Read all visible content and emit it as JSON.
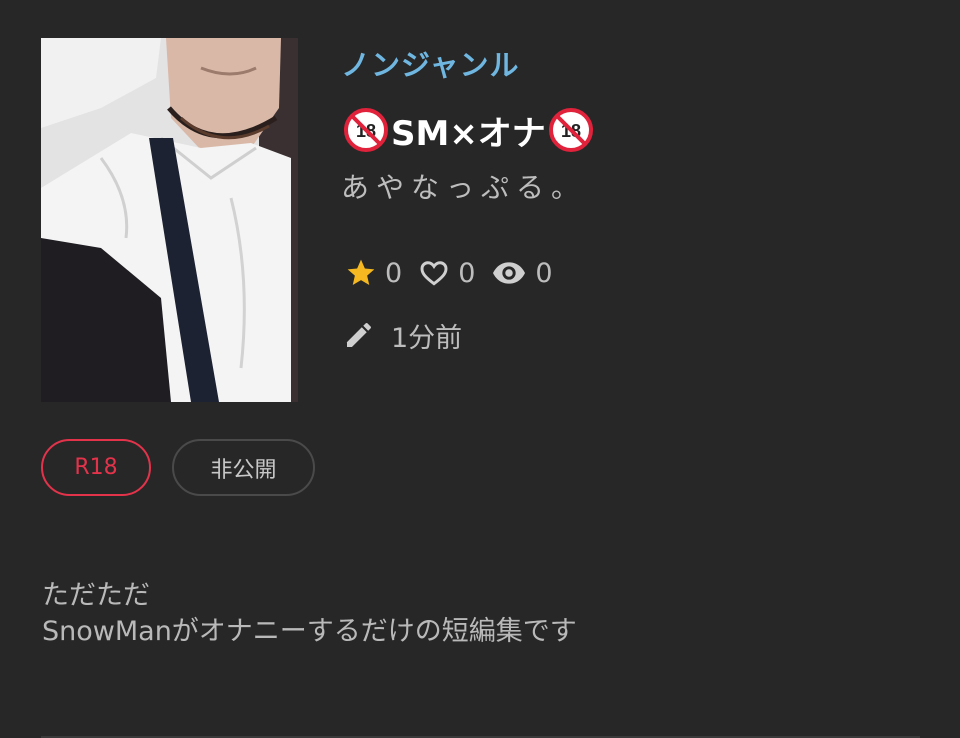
{
  "work": {
    "genre": "ノンジャンル",
    "title_text": "SM×オナ",
    "author": "あやなっぷる。",
    "cover_icon": "cover-image",
    "badge_icon": "no-under-18-icon"
  },
  "stats": {
    "stars": "0",
    "hearts": "0",
    "views": "0",
    "star_color": "#f5b820"
  },
  "updated": "1分前",
  "tags": {
    "r18": "R18",
    "private": "非公開"
  },
  "description": {
    "line1": "ただただ",
    "line2": "SnowManがオナニーするだけの短編集です"
  },
  "colors": {
    "background": "#272727",
    "genre": "#6fb6e0",
    "r18": "#e2334b"
  }
}
